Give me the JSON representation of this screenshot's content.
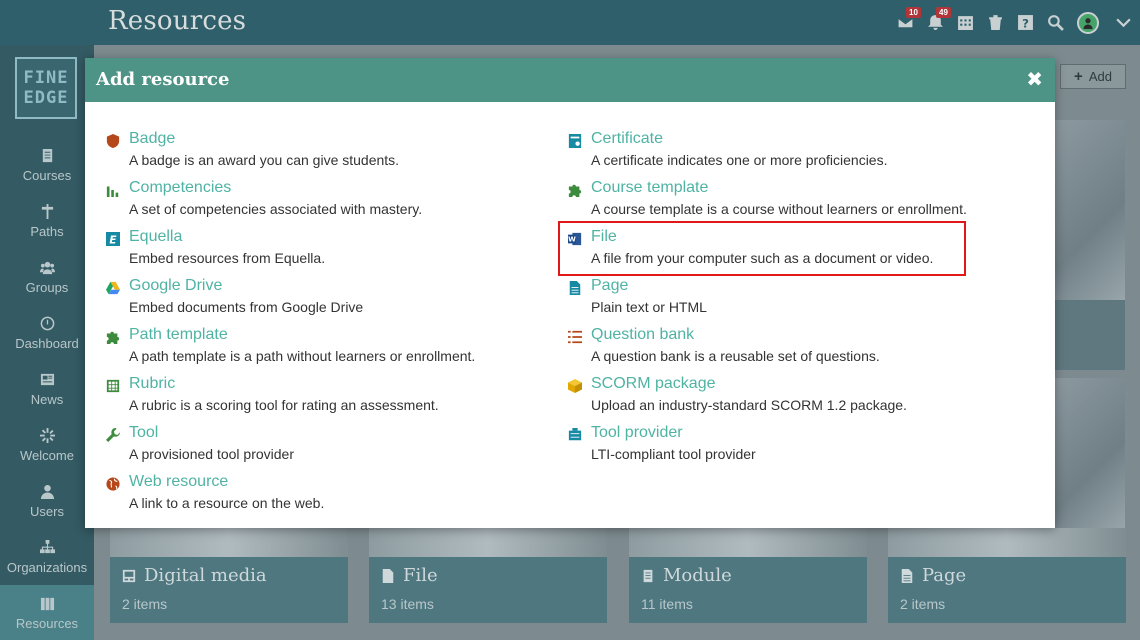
{
  "header": {
    "title": "Resources",
    "mail_count": "10",
    "notifications_count": "49"
  },
  "sidebar": {
    "logo_line1": "FINE",
    "logo_line2": "EDGE",
    "items": [
      {
        "label": "Courses",
        "icon": "courses-icon"
      },
      {
        "label": "Paths",
        "icon": "signpost-icon"
      },
      {
        "label": "Groups",
        "icon": "groups-icon"
      },
      {
        "label": "Dashboard",
        "icon": "dashboard-icon"
      },
      {
        "label": "News",
        "icon": "news-icon"
      },
      {
        "label": "Welcome",
        "icon": "welcome-icon"
      },
      {
        "label": "Users",
        "icon": "user-icon"
      },
      {
        "label": "Organizations",
        "icon": "org-icon"
      },
      {
        "label": "Resources",
        "icon": "resources-icon"
      }
    ]
  },
  "toolbar": {
    "add_label": "Add"
  },
  "cards": [
    {
      "title": "Digital media",
      "count": "2 items"
    },
    {
      "title": "File",
      "count": "13 items"
    },
    {
      "title": "Module",
      "count": "11 items"
    },
    {
      "title": "Page",
      "count": "2 items"
    }
  ],
  "modal": {
    "title": "Add resource",
    "close": "✖",
    "left": [
      {
        "name": "Badge",
        "desc": "A badge is an award you can give students.",
        "icon": "shield-icon",
        "color": "#b5471b"
      },
      {
        "name": "Competencies",
        "desc": "A set of competencies associated with mastery.",
        "icon": "bar-chart-icon",
        "color": "#3d8b3d"
      },
      {
        "name": "Equella",
        "desc": "Embed resources from Equella.",
        "icon": "equella-icon",
        "color": "#178aa3"
      },
      {
        "name": "Google Drive",
        "desc": "Embed documents from Google Drive",
        "icon": "google-drive-icon",
        "color": "#f2b619"
      },
      {
        "name": "Path template",
        "desc": "A path template is a path without learners or enrollment.",
        "icon": "puzzle-icon",
        "color": "#3d8b3d"
      },
      {
        "name": "Rubric",
        "desc": "A rubric is a scoring tool for rating an assessment.",
        "icon": "grid-icon",
        "color": "#3d8b3d"
      },
      {
        "name": "Tool",
        "desc": "A provisioned tool provider",
        "icon": "wrench-icon",
        "color": "#3d8b3d"
      },
      {
        "name": "Web resource",
        "desc": "A link to a resource on the web.",
        "icon": "globe-icon",
        "color": "#b5471b"
      }
    ],
    "right": [
      {
        "name": "Certificate",
        "desc": "A certificate indicates one or more proficiencies.",
        "icon": "certificate-icon",
        "color": "#178aa3"
      },
      {
        "name": "Course template",
        "desc": "A course template is a course without learners or enrollment.",
        "icon": "puzzle-icon",
        "color": "#3d8b3d"
      },
      {
        "name": "File",
        "desc": "A file from your computer such as a document or video.",
        "icon": "word-file-icon",
        "color": "#2b5797"
      },
      {
        "name": "Page",
        "desc": "Plain text or HTML",
        "icon": "page-icon",
        "color": "#178aa3"
      },
      {
        "name": "Question bank",
        "desc": "A question bank is a reusable set of questions.",
        "icon": "list-icon",
        "color": "#b5471b"
      },
      {
        "name": "SCORM package",
        "desc": "Upload an industry-standard SCORM 1.2 package.",
        "icon": "package-icon",
        "color": "#e0a800"
      },
      {
        "name": "Tool provider",
        "desc": "LTI-compliant tool provider",
        "icon": "tool-provider-icon",
        "color": "#178aa3"
      }
    ]
  }
}
